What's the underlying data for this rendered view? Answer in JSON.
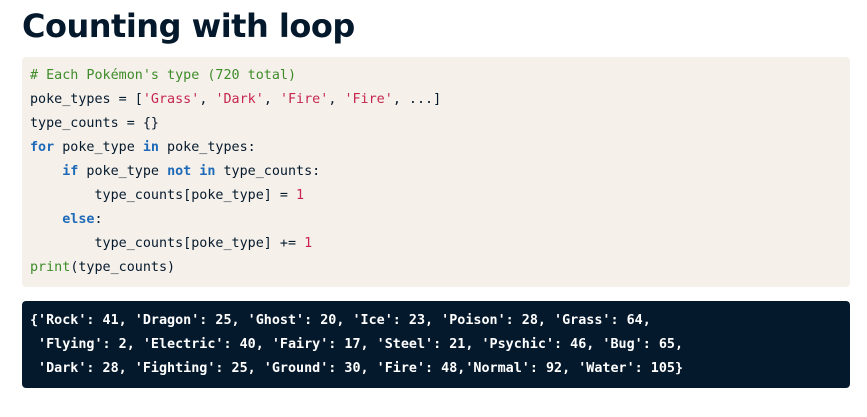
{
  "slide": {
    "title": "Counting with loop"
  },
  "code": {
    "line1_comment": "# Each Pokémon's type (720 total)",
    "line2_a": "poke_types = [",
    "line2_s1": "'Grass'",
    "line2_sep1": ", ",
    "line2_s2": "'Dark'",
    "line2_sep2": ", ",
    "line2_s3": "'Fire'",
    "line2_sep3": ", ",
    "line2_s4": "'Fire'",
    "line2_end": ", ...]",
    "line3": "type_counts = {}",
    "line4_kw1": "for",
    "line4_mid": " poke_type ",
    "line4_kw2": "in",
    "line4_end": " poke_types:",
    "line5_indent": "    ",
    "line5_kw1": "if",
    "line5_mid": " poke_type ",
    "line5_kw2": "not in",
    "line5_end": " type_counts:",
    "line6_a": "        type_counts[poke_type] = ",
    "line6_num": "1",
    "line7_indent": "    ",
    "line7_kw": "else",
    "line7_end": ":",
    "line8_a": "        type_counts[poke_type] += ",
    "line8_num": "1",
    "line9_fn": "print",
    "line9_end": "(type_counts)"
  },
  "output": {
    "line1": "{'Rock': 41, 'Dragon': 25, 'Ghost': 20, 'Ice': 23, 'Poison': 28, 'Grass': 64,",
    "line2": " 'Flying': 2, 'Electric': 40, 'Fairy': 17, 'Steel': 21, 'Psychic': 46, 'Bug': 65,",
    "line3": " 'Dark': 28, 'Fighting': 25, 'Ground': 30, 'Fire': 48,'Normal': 92, 'Water': 105}"
  }
}
